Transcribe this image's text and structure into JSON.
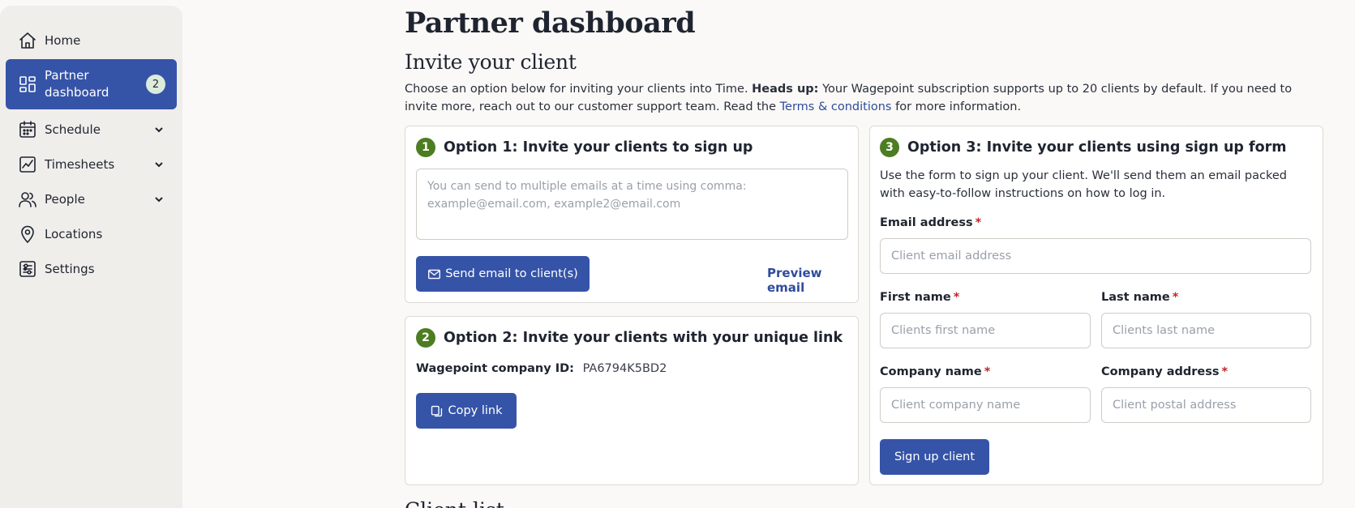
{
  "sidebar": {
    "items": [
      {
        "label": "Home",
        "icon": "home-icon",
        "active": false,
        "expandable": false
      },
      {
        "label": "Partner dashboard",
        "icon": "dashboard-icon",
        "active": true,
        "expandable": false,
        "badge": "2"
      },
      {
        "label": "Schedule",
        "icon": "calendar-icon",
        "active": false,
        "expandable": true
      },
      {
        "label": "Timesheets",
        "icon": "chart-icon",
        "active": false,
        "expandable": true
      },
      {
        "label": "People",
        "icon": "people-icon",
        "active": false,
        "expandable": true
      },
      {
        "label": "Locations",
        "icon": "map-pin-icon",
        "active": false,
        "expandable": false
      },
      {
        "label": "Settings",
        "icon": "settings-icon",
        "active": false,
        "expandable": false
      }
    ]
  },
  "page": {
    "title": "Partner dashboard",
    "section_title": "Invite your client",
    "intro_part1": "Choose an option below for inviting your clients into Time. ",
    "intro_bold": "Heads up:",
    "intro_part2": " Your Wagepoint subscription supports up to 20 clients by default. If you need to invite more, reach out to our customer support team. Read the ",
    "intro_link": "Terms & conditions",
    "intro_part3": " for more information.",
    "footer_peek": "Client list"
  },
  "option1": {
    "step": "1",
    "title": "Option 1: Invite your clients to sign up",
    "placeholder": "You can send to multiple emails at a time using comma: example@email.com, example2@email.com",
    "send_label": "Send email to client(s)",
    "preview_label": "Preview email"
  },
  "option2": {
    "step": "2",
    "title": "Option 2: Invite your clients with your unique link",
    "id_label": "Wagepoint company ID:",
    "id_value": "PA6794K5BD2",
    "copy_label": "Copy link"
  },
  "option3": {
    "step": "3",
    "title": "Option 3: Invite your clients using sign up form",
    "description": "Use the form to sign up your client. We'll send them an email packed with easy-to-follow instructions on how to log in.",
    "required_mark": "*",
    "email_label": "Email address",
    "email_placeholder": "Client email address",
    "first_label": "First name",
    "first_placeholder": "Clients first name",
    "last_label": "Last name",
    "last_placeholder": "Clients last name",
    "company_label": "Company name",
    "company_placeholder": "Client company name",
    "address_label": "Company address",
    "address_placeholder": "Client postal address",
    "submit_label": "Sign up client"
  },
  "colors": {
    "primary": "#3554a8",
    "step_green": "#4d7d22",
    "link": "#2f4c9c",
    "required": "#c0262d"
  }
}
